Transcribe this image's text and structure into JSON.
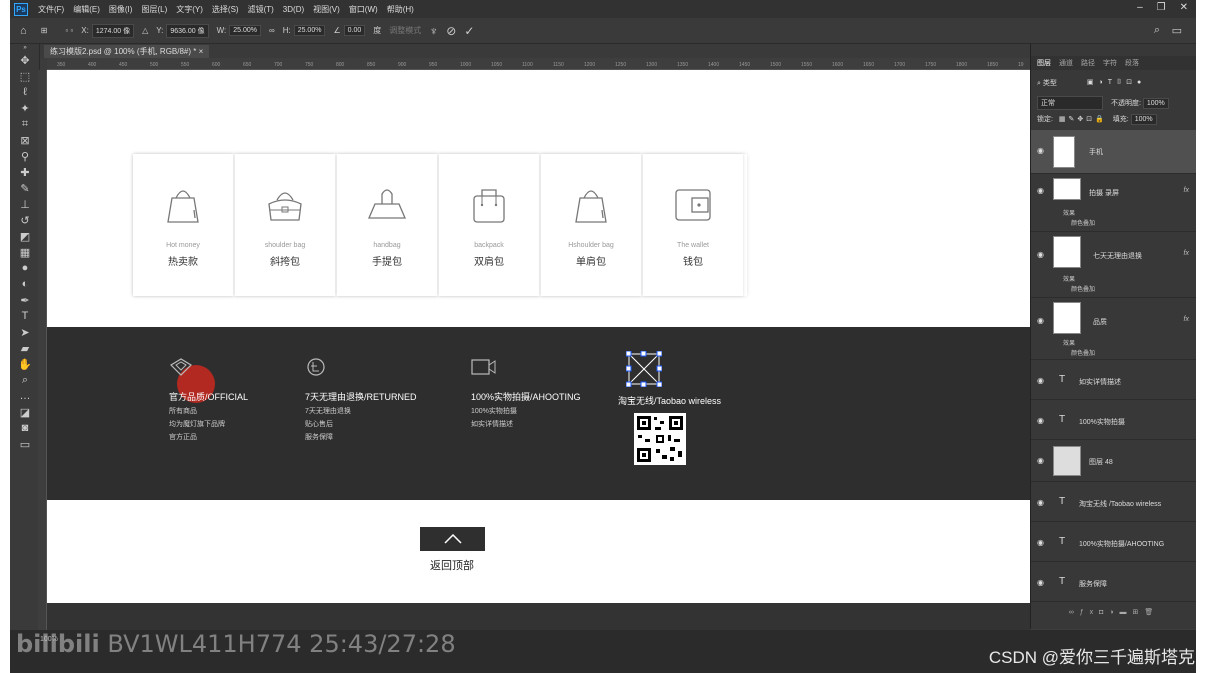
{
  "menubar": {
    "logo": "Ps",
    "items": [
      "文件(F)",
      "编辑(E)",
      "图像(I)",
      "图层(L)",
      "文字(Y)",
      "选择(S)",
      "滤镜(T)",
      "3D(D)",
      "视图(V)",
      "窗口(W)",
      "帮助(H)"
    ]
  },
  "optbar": {
    "x_label": "X:",
    "x_value": "1274.00 像",
    "y_label": "Y:",
    "y_value": "9636.00 像",
    "w_label": "W:",
    "w_value": "25.00%",
    "h_label": "H:",
    "h_value": "25.00%",
    "angle_value": "0.00",
    "interp": "度",
    "mode": "调整模式"
  },
  "document": {
    "tab_title": "练习模版2.psd @ 100% (手机, RGB/8#) * ×"
  },
  "ruler_ticks": [
    "350",
    "400",
    "450",
    "500",
    "550",
    "600",
    "650",
    "700",
    "750",
    "800",
    "850",
    "900",
    "950",
    "1000",
    "1050",
    "1100",
    "1150",
    "1200",
    "1250",
    "1300",
    "1350",
    "1400",
    "1450",
    "1500",
    "1550",
    "1600",
    "1650",
    "1700",
    "1750",
    "1800",
    "1850",
    "19"
  ],
  "cards": [
    {
      "en": "Hot money",
      "cn": "热卖款",
      "icon": "bag-icon"
    },
    {
      "en": "shoulder bag",
      "cn": "斜挎包",
      "icon": "shoulder-bag-icon"
    },
    {
      "en": "handbag",
      "cn": "手提包",
      "icon": "handbag-icon"
    },
    {
      "en": "backpack",
      "cn": "双肩包",
      "icon": "backpack-icon"
    },
    {
      "en": "Hshoulder bag",
      "cn": "单肩包",
      "icon": "bag-icon"
    },
    {
      "en": "The wallet",
      "cn": "钱包",
      "icon": "wallet-icon"
    }
  ],
  "footer": {
    "col1": {
      "title": "官方品质/OFFICIAL",
      "lines": [
        "所有商品",
        "均为魔灯旗下品牌",
        "官方正品"
      ]
    },
    "col2": {
      "title": "7天无理由退换/RETURNED",
      "lines": [
        "7天无理由退换",
        "贴心售后",
        "服务保障"
      ]
    },
    "col3": {
      "title": "100%实物拍摄/AHOOTING",
      "lines": [
        "100%实物拍摄",
        "如实详情描述"
      ]
    },
    "col4": {
      "title": "淘宝无线/Taobao wireless"
    }
  },
  "back_to_top": "返回顶部",
  "panel": {
    "tabs": [
      "图层",
      "通道",
      "路径",
      "字符",
      "段落"
    ],
    "search": "类型",
    "blend_mode": "正常",
    "opacity_label": "不透明度:",
    "opacity_value": "100%",
    "lock_label": "锁定:",
    "fill_label": "填充:",
    "fill_value": "100%",
    "layers": [
      {
        "name": "手机",
        "type": "image"
      },
      {
        "name": "拍摄 录屏",
        "type": "image",
        "fx": "fx",
        "subs": [
          "效果",
          "颜色叠加"
        ]
      },
      {
        "name": "七天无理由退换",
        "type": "image",
        "fx": "fx",
        "subs": [
          "效果",
          "颜色叠加"
        ]
      },
      {
        "name": "品质",
        "type": "image",
        "fx": "fx",
        "subs": [
          "效果",
          "颜色叠加"
        ]
      },
      {
        "name": "如实详情描述",
        "type": "text"
      },
      {
        "name": "100%实物拍摄",
        "type": "text"
      },
      {
        "name": "图层 48",
        "type": "image"
      },
      {
        "name": "淘宝无线 /Taobao wireless",
        "type": "text"
      },
      {
        "name": "100%实物拍摄/AHOOTING",
        "type": "text"
      },
      {
        "name": "服务保障",
        "type": "text"
      }
    ]
  },
  "status": "100%",
  "watermark_left": "BV1WL411H774 25:43/27:28",
  "watermark_right": "CSDN @爱你三千遍斯塔克"
}
